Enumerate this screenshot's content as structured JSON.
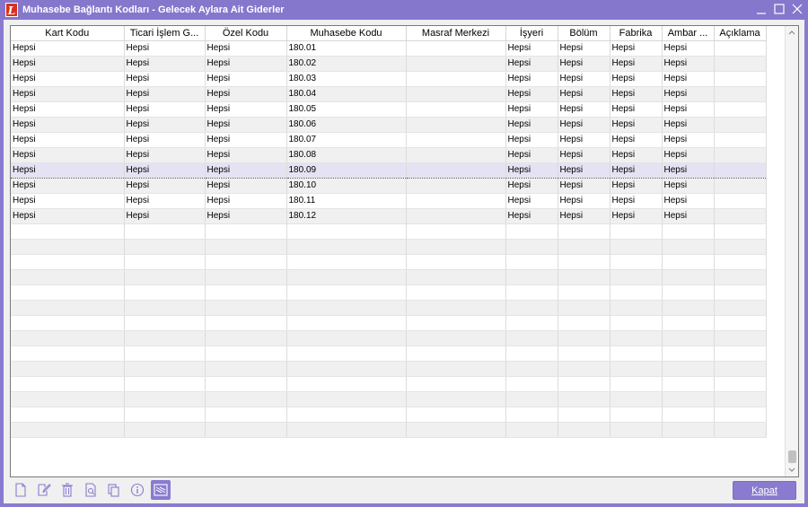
{
  "window": {
    "title": "Muhasebe Bağlantı Kodları - Gelecek Aylara Ait Giderler",
    "app_icon_letter": "L"
  },
  "grid": {
    "columns": [
      "Kart Kodu",
      "Ticari İşlem G...",
      "Özel Kodu",
      "Muhasebe Kodu",
      "Masraf Merkezi",
      "İşyeri",
      "Bölüm",
      "Fabrika",
      "Ambar ...",
      "Açıklama"
    ],
    "rows": [
      [
        "Hepsi",
        "Hepsi",
        "Hepsi",
        "180.01",
        "",
        "Hepsi",
        "Hepsi",
        "Hepsi",
        "Hepsi",
        ""
      ],
      [
        "Hepsi",
        "Hepsi",
        "Hepsi",
        "180.02",
        "",
        "Hepsi",
        "Hepsi",
        "Hepsi",
        "Hepsi",
        ""
      ],
      [
        "Hepsi",
        "Hepsi",
        "Hepsi",
        "180.03",
        "",
        "Hepsi",
        "Hepsi",
        "Hepsi",
        "Hepsi",
        ""
      ],
      [
        "Hepsi",
        "Hepsi",
        "Hepsi",
        "180.04",
        "",
        "Hepsi",
        "Hepsi",
        "Hepsi",
        "Hepsi",
        ""
      ],
      [
        "Hepsi",
        "Hepsi",
        "Hepsi",
        "180.05",
        "",
        "Hepsi",
        "Hepsi",
        "Hepsi",
        "Hepsi",
        ""
      ],
      [
        "Hepsi",
        "Hepsi",
        "Hepsi",
        "180.06",
        "",
        "Hepsi",
        "Hepsi",
        "Hepsi",
        "Hepsi",
        ""
      ],
      [
        "Hepsi",
        "Hepsi",
        "Hepsi",
        "180.07",
        "",
        "Hepsi",
        "Hepsi",
        "Hepsi",
        "Hepsi",
        ""
      ],
      [
        "Hepsi",
        "Hepsi",
        "Hepsi",
        "180.08",
        "",
        "Hepsi",
        "Hepsi",
        "Hepsi",
        "Hepsi",
        ""
      ],
      [
        "Hepsi",
        "Hepsi",
        "Hepsi",
        "180.09",
        "",
        "Hepsi",
        "Hepsi",
        "Hepsi",
        "Hepsi",
        ""
      ],
      [
        "Hepsi",
        "Hepsi",
        "Hepsi",
        "180.10",
        "",
        "Hepsi",
        "Hepsi",
        "Hepsi",
        "Hepsi",
        ""
      ],
      [
        "Hepsi",
        "Hepsi",
        "Hepsi",
        "180.11",
        "",
        "Hepsi",
        "Hepsi",
        "Hepsi",
        "Hepsi",
        ""
      ],
      [
        "Hepsi",
        "Hepsi",
        "Hepsi",
        "180.12",
        "",
        "Hepsi",
        "Hepsi",
        "Hepsi",
        "Hepsi",
        ""
      ]
    ],
    "selected_row": 8,
    "empty_rows": 14
  },
  "toolbar": {
    "icons": [
      "new-document-icon",
      "edit-icon",
      "delete-icon",
      "preview-icon",
      "copy-icon",
      "info-icon",
      "filter-icon"
    ],
    "active_icon": "filter-icon"
  },
  "footer": {
    "close_label": "Kapat"
  },
  "colors": {
    "accent": "#8a7bd0",
    "title_bar": "#8577cc",
    "selected_row": "#e4e2f3",
    "alt_row": "#f0f0f0"
  }
}
